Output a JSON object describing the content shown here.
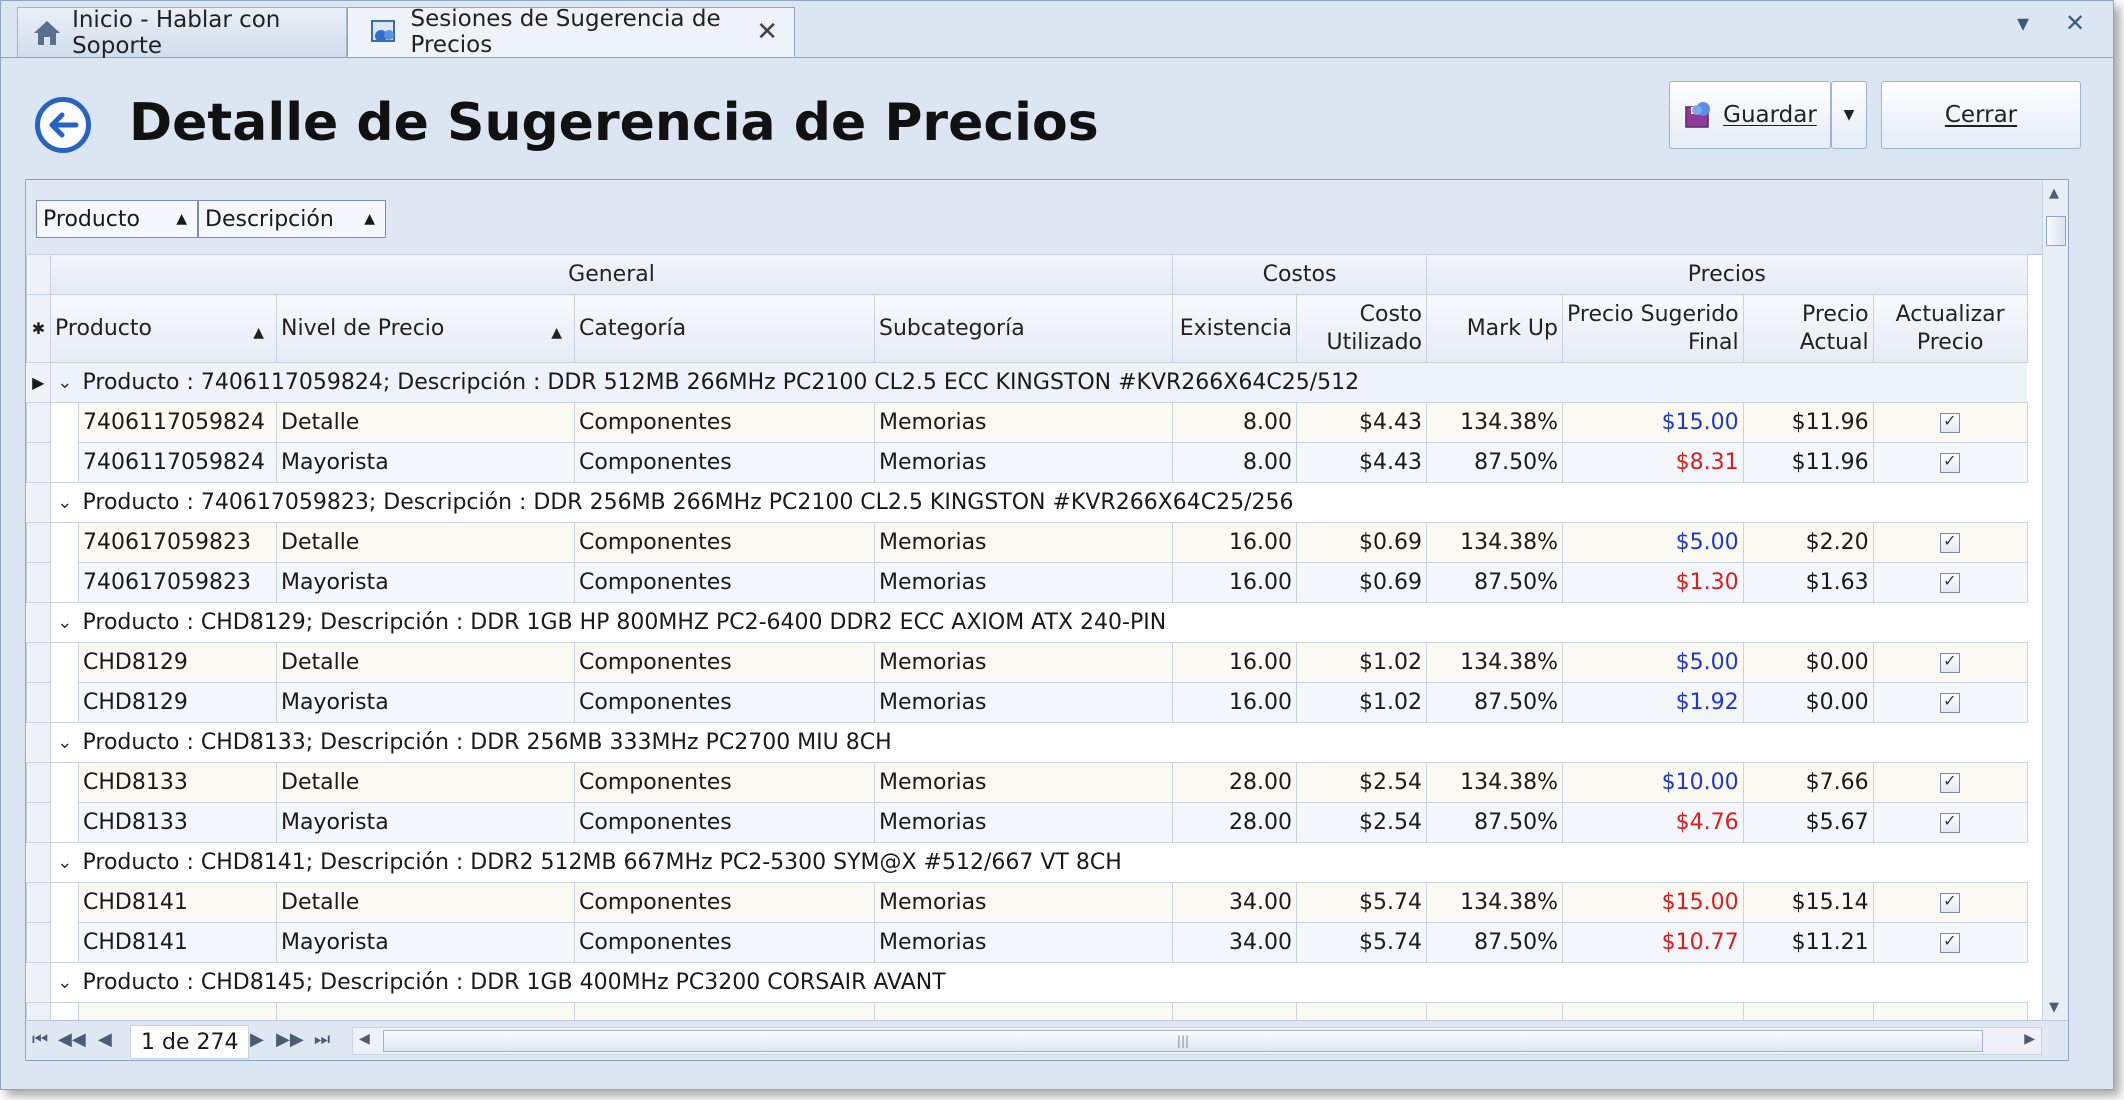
{
  "tabs": [
    {
      "label": "Inicio - Hablar con Soporte",
      "icon": "home-icon"
    },
    {
      "label": "Sesiones de Sugerencia de Precios",
      "icon": "price-session-icon"
    }
  ],
  "header": {
    "title": "Detalle de Sugerencia de Precios",
    "save_label": "Guardar",
    "close_label": "Cerrar"
  },
  "group_by": [
    "Producto",
    "Descripción"
  ],
  "bands": {
    "general": "General",
    "costos": "Costos",
    "precios": "Precios"
  },
  "columns": {
    "producto": "Producto",
    "nivel": "Nivel de Precio",
    "categoria": "Categoría",
    "subcategoria": "Subcategoría",
    "existencia": "Existencia",
    "costo1": "Costo",
    "costo2": "Utilizado",
    "markup": "Mark Up",
    "sugerido1": "Precio Sugerido",
    "sugerido2": "Final",
    "actual1": "Precio",
    "actual2": "Actual",
    "actualizar1": "Actualizar",
    "actualizar2": "Precio"
  },
  "groups": [
    {
      "label": "Producto : 7406117059824;  Descripción : DDR 512MB 266MHz PC2100 CL2.5 ECC KINGSTON #KVR266X64C25/512",
      "rows": [
        {
          "producto": "7406117059824",
          "nivel": "Detalle",
          "categoria": "Componentes",
          "subcategoria": "Memorias",
          "existencia": "8.00",
          "costo": "$4.43",
          "markup": "134.38%",
          "sugerido": "$15.00",
          "color": "blue",
          "actual": "$11.96"
        },
        {
          "producto": "7406117059824",
          "nivel": "Mayorista",
          "categoria": "Componentes",
          "subcategoria": "Memorias",
          "existencia": "8.00",
          "costo": "$4.43",
          "markup": "87.50%",
          "sugerido": "$8.31",
          "color": "red",
          "actual": "$11.96"
        }
      ]
    },
    {
      "label": "Producto : 740617059823;  Descripción : DDR 256MB 266MHz PC2100 CL2.5 KINGSTON #KVR266X64C25/256",
      "rows": [
        {
          "producto": "740617059823",
          "nivel": "Detalle",
          "categoria": "Componentes",
          "subcategoria": "Memorias",
          "existencia": "16.00",
          "costo": "$0.69",
          "markup": "134.38%",
          "sugerido": "$5.00",
          "color": "blue",
          "actual": "$2.20"
        },
        {
          "producto": "740617059823",
          "nivel": "Mayorista",
          "categoria": "Componentes",
          "subcategoria": "Memorias",
          "existencia": "16.00",
          "costo": "$0.69",
          "markup": "87.50%",
          "sugerido": "$1.30",
          "color": "red",
          "actual": "$1.63"
        }
      ]
    },
    {
      "label": "Producto : CHD8129;  Descripción : DDR 1GB  HP 800MHZ PC2-6400 DDR2 ECC AXIOM ATX 240-PIN",
      "rows": [
        {
          "producto": "CHD8129",
          "nivel": "Detalle",
          "categoria": "Componentes",
          "subcategoria": "Memorias",
          "existencia": "16.00",
          "costo": "$1.02",
          "markup": "134.38%",
          "sugerido": "$5.00",
          "color": "blue",
          "actual": "$0.00"
        },
        {
          "producto": "CHD8129",
          "nivel": "Mayorista",
          "categoria": "Componentes",
          "subcategoria": "Memorias",
          "existencia": "16.00",
          "costo": "$1.02",
          "markup": "87.50%",
          "sugerido": "$1.92",
          "color": "blue",
          "actual": "$0.00"
        }
      ]
    },
    {
      "label": "Producto : CHD8133;  Descripción : DDR 256MB 333MHz PC2700 MIU 8CH",
      "rows": [
        {
          "producto": "CHD8133",
          "nivel": "Detalle",
          "categoria": "Componentes",
          "subcategoria": "Memorias",
          "existencia": "28.00",
          "costo": "$2.54",
          "markup": "134.38%",
          "sugerido": "$10.00",
          "color": "blue",
          "actual": "$7.66"
        },
        {
          "producto": "CHD8133",
          "nivel": "Mayorista",
          "categoria": "Componentes",
          "subcategoria": "Memorias",
          "existencia": "28.00",
          "costo": "$2.54",
          "markup": "87.50%",
          "sugerido": "$4.76",
          "color": "red",
          "actual": "$5.67"
        }
      ]
    },
    {
      "label": "Producto : CHD8141;  Descripción : DDR2 512MB 667MHz PC2-5300 SYM@X  #512/667 VT 8CH",
      "rows": [
        {
          "producto": "CHD8141",
          "nivel": "Detalle",
          "categoria": "Componentes",
          "subcategoria": "Memorias",
          "existencia": "34.00",
          "costo": "$5.74",
          "markup": "134.38%",
          "sugerido": "$15.00",
          "color": "red",
          "actual": "$15.14"
        },
        {
          "producto": "CHD8141",
          "nivel": "Mayorista",
          "categoria": "Componentes",
          "subcategoria": "Memorias",
          "existencia": "34.00",
          "costo": "$5.74",
          "markup": "87.50%",
          "sugerido": "$10.77",
          "color": "red",
          "actual": "$11.21"
        }
      ]
    },
    {
      "label": "Producto : CHD8145;  Descripción : DDR 1GB 400MHz PC3200 CORSAIR AVANT",
      "rows": []
    }
  ],
  "pager": {
    "page_info": "1 de 274"
  },
  "colors": {
    "blue_price": "#1f36d6",
    "red_price": "#e01b1b",
    "accent": "#2563c4"
  }
}
